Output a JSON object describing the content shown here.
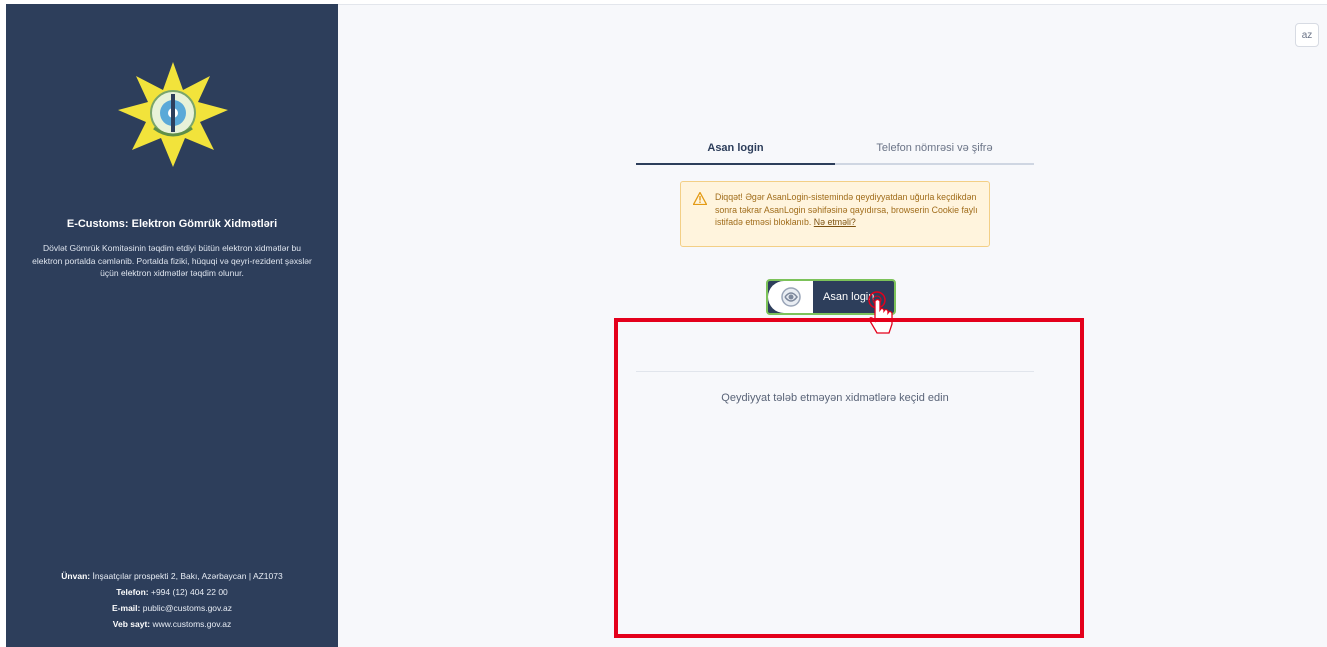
{
  "sidebar": {
    "title": "E-Customs: Elektron Gömrük Xidmətləri",
    "description": "Dövlət Gömrük Komitəsinin təqdim etdiyi bütün elektron xidmətlər bu elektron portalda cəmlənib. Portalda fiziki, hüquqi və qeyri-rezident şəxslər üçün elektron xidmətlər təqdim olunur.",
    "contact": {
      "address_label": "Ünvan:",
      "address": " İnşaatçılar prospekti 2, Bakı, Azərbaycan | AZ1073",
      "phone_label": "Telefon:",
      "phone": " +994 (12) 404 22 00",
      "email_label": "E-mail:",
      "email": " public@customs.gov.az",
      "website_label": "Veb sayt:",
      "website": " www.customs.gov.az"
    }
  },
  "header": {
    "language": "az"
  },
  "tabs": [
    {
      "label": "Asan login",
      "active": true
    },
    {
      "label": "Telefon nömrəsi və şifrə",
      "active": false
    }
  ],
  "alert": {
    "text": "Diqqət! Əgər AsanLogin-sistemində qeydiyyatdan uğurla keçdikdən sonra təkrar AsanLogin səhifəsinə qayıdırsa, browserin Cookie faylı istifadə etməsi bloklanıb. ",
    "link": "Nə etməli?",
    "icon": "warning-icon"
  },
  "asan_button": {
    "label": "Asan login",
    "icon": "asan-logo-icon"
  },
  "guest_link": "Qeydiyyat tələb etməyən xidmətlərə keçid edin",
  "colors": {
    "sidebar": "#2d3e5b",
    "highlight": "#e4001b",
    "button_border": "#7cc25a",
    "alert_bg": "#fff4dd"
  }
}
